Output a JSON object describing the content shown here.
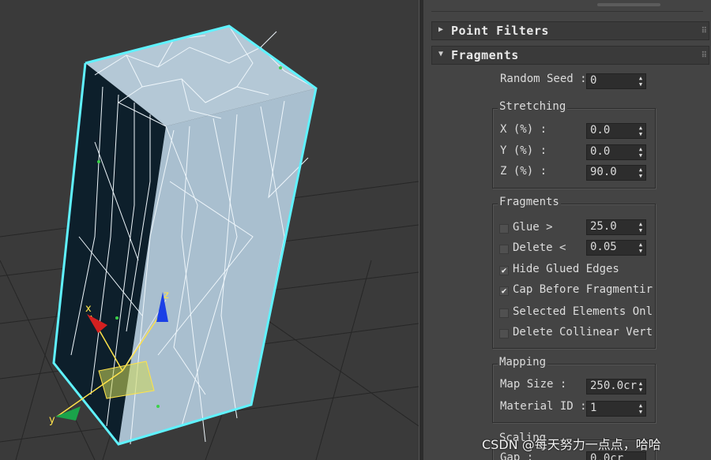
{
  "rollouts": {
    "point_filters": "Point Filters",
    "fragments": "Fragments"
  },
  "random_seed": {
    "label": "Random Seed :",
    "value": "0"
  },
  "stretching": {
    "title": "Stretching",
    "x_label": "X (%) :",
    "x_value": "0.0",
    "y_label": "Y (%) :",
    "y_value": "0.0",
    "z_label": "Z (%) :",
    "z_value": "90.0"
  },
  "fragments_group": {
    "title": "Fragments",
    "glue_label": "Glue >",
    "glue_value": "25.0",
    "delete_label": "Delete <",
    "delete_value": "0.05",
    "hide_glued_edges": "Hide Glued Edges",
    "cap_before": "Cap Before Fragmentir",
    "selected_elements": "Selected Elements Onl",
    "delete_collinear": "Delete Collinear Vert"
  },
  "mapping": {
    "title": "Mapping",
    "map_size_label": "Map Size :",
    "map_size_value": "250.0cr",
    "material_id_label": "Material ID :",
    "material_id_value": "1"
  },
  "scaling": {
    "title": "Scaling",
    "gap_label": "Gap :",
    "gap_value": "0.0cr"
  },
  "viewport": {
    "axis_x": "x",
    "axis_y": "y",
    "axis_z": "z"
  },
  "watermark": "CSDN @每天努力一点点，哈哈",
  "colors": {
    "selection": "#5ff2ff",
    "box_face": "#a9bfcf",
    "box_dark": "#0d1f2b",
    "grid": "#222222"
  }
}
